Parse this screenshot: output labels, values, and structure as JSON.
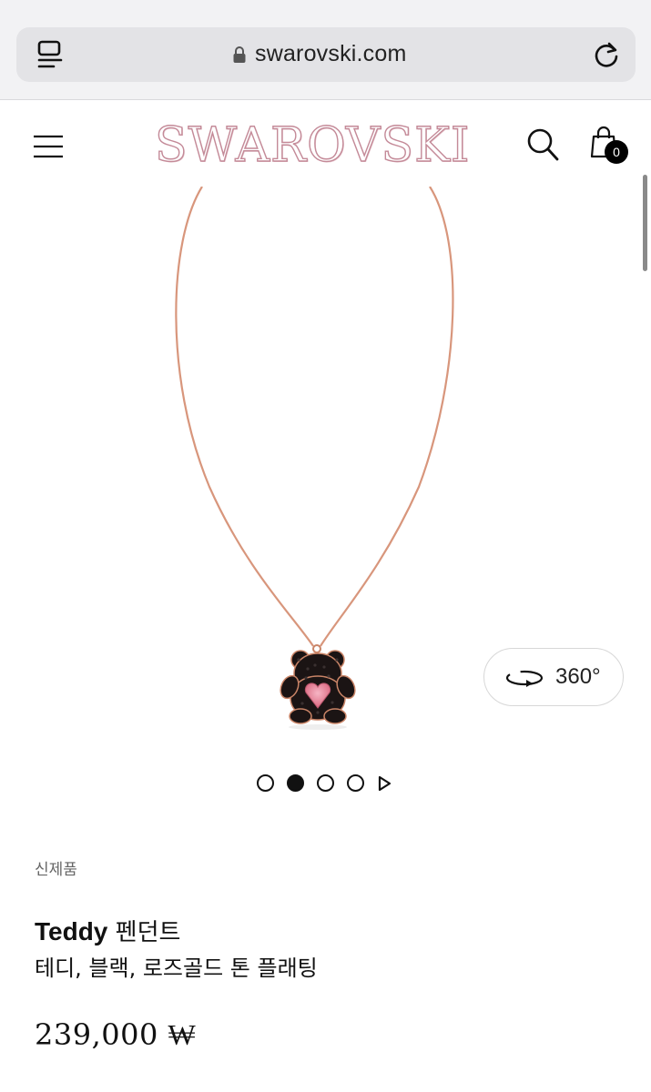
{
  "browser": {
    "url": "swarovski.com",
    "icons": [
      "tabs-icon",
      "lock-icon",
      "reload-icon"
    ]
  },
  "header": {
    "logo_text": "SWAROVSKI",
    "cart_count": "0",
    "icons": [
      "menu-icon",
      "search-icon",
      "shopping-bag-icon"
    ]
  },
  "gallery": {
    "view_360_label": "360°",
    "slide_count": 4,
    "active_slide": 2
  },
  "product": {
    "badge": "신제품",
    "name": "Teddy",
    "type": "펜던트",
    "subtitle": "테디, 블랙, 로즈골드 톤 플래팅",
    "price": "239,000 ₩"
  },
  "colors": {
    "logo_outline": "#c48a98",
    "chain": "#d8967c",
    "heart_crystal": "#e58aa1"
  }
}
